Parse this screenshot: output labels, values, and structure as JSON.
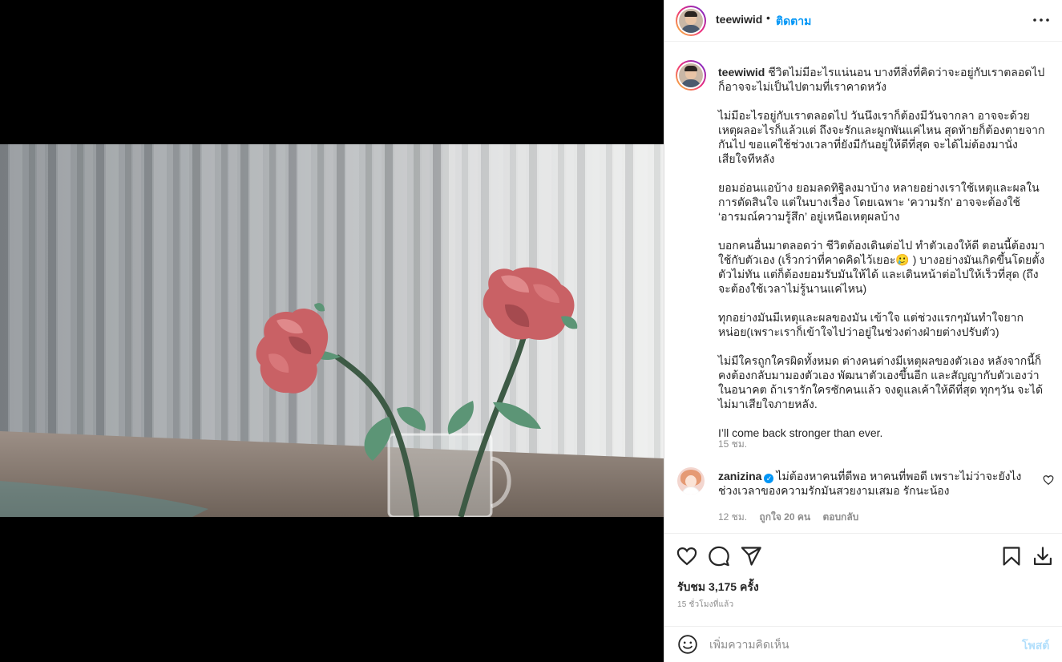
{
  "post": {
    "username": "teewiwid",
    "dot": "•",
    "follow_label": "ติดตาม"
  },
  "caption": {
    "username": "teewiwid",
    "first_line": "ชีวิตไม่มีอะไรแน่นอน บางทีสิ่งที่คิดว่าจะอยู่กับเราตลอดไป ก็อาจจะไม่เป็นไปตามที่เราคาดหวัง",
    "paragraphs": [
      "ไม่มีอะไรอยู่กับเราตลอดไป วันนึงเราก็ต้องมีวันจากลา อาจจะด้วยเหตุผลอะไรก็แล้วแต่ ถึงจะรักและผูกพันแค่ไหน สุดท้ายก็ต้องตายจากกันไป ขอแค่ใช้ช่วงเวลาที่ยังมีกันอยู่ให้ดีที่สุด จะได้ไม่ต้องมานั่งเสียใจทีหลัง",
      "ยอมอ่อนแอบ้าง ยอมลดทิฐิลงมาบ้าง หลายอย่างเราใช้เหตุและผลในการตัดสินใจ แต่ในบางเรื่อง โดยเฉพาะ ‘ความรัก’ อาจจะต้องใช้ ‘อารมณ์ความรู้สึก’ อยู่เหนือเหตุผลบ้าง",
      "บอกคนอื่นมาตลอดว่า ชีวิตต้องเดินต่อไป ทำตัวเองให้ดี ตอนนี้ต้องมาใช้กับตัวเอง (เร็วกว่าที่คาดคิดไว้เยอะ🥲 ) บางอย่างมันเกิดขึ้นโดยตั้งตัวไม่ทัน แต่ก็ต้องยอมรับมันให้ได้ และเดินหน้าต่อไปให้เร็วที่สุด (ถึงจะต้องใช้เวลาไม่รู้นานแค่ไหน)",
      "ทุกอย่างมันมีเหตุและผลของมัน เข้าใจ แต่ช่วงแรกๆมันทำใจยากหน่อย(เพราะเราก็เข้าใจไปว่าอยู่ในช่วงต่างฝ่ายต่างปรับตัว)",
      "ไม่มีใครถูกใครผิดทั้งหมด ต่างคนต่างมีเหตุผลของตัวเอง หลังจากนี้ก็คงต้องกลับมามองตัวเอง พัฒนาตัวเองขึ้นอีก และสัญญากับตัวเองว่า ในอนาคต ถ้าเรารักใครซักคนแล้ว จงดูแลเค้าให้ดีที่สุด ทุกๆวัน จะได้ไม่มาเสียใจภายหลัง.",
      "I’ll come back stronger than ever."
    ],
    "time": "15 ชม."
  },
  "comment": {
    "username": "zanizina",
    "verified_mark": "✓",
    "text": "ไม่ต้องหาคนที่ดีพอ หาคนที่พอดี เพราะไม่ว่าจะยังไงช่วงเวลาของความรักมันสวยงามเสมอ รักนะน้อง",
    "time": "12 ชม.",
    "likes": "ถูกใจ 20 คน",
    "reply_label": "ตอบกลับ"
  },
  "actions": {
    "likes_total": "รับชม 3,175 ครั้ง",
    "posted_ago": "15 ชั่วโมงที่แล้ว"
  },
  "add_comment": {
    "placeholder": "เพิ่มความคิดเห็น",
    "post_label": "โพสต์"
  },
  "icons": {
    "more": "more-horizontal-icon",
    "like": "heart-icon",
    "comment": "comment-bubble-icon",
    "share": "paper-plane-icon",
    "save": "bookmark-icon",
    "download": "download-icon",
    "emoji": "emoji-smile-icon"
  },
  "colors": {
    "accent": "#0095f6",
    "post_disabled": "#b2dffc",
    "muted": "#8e8e8e"
  }
}
